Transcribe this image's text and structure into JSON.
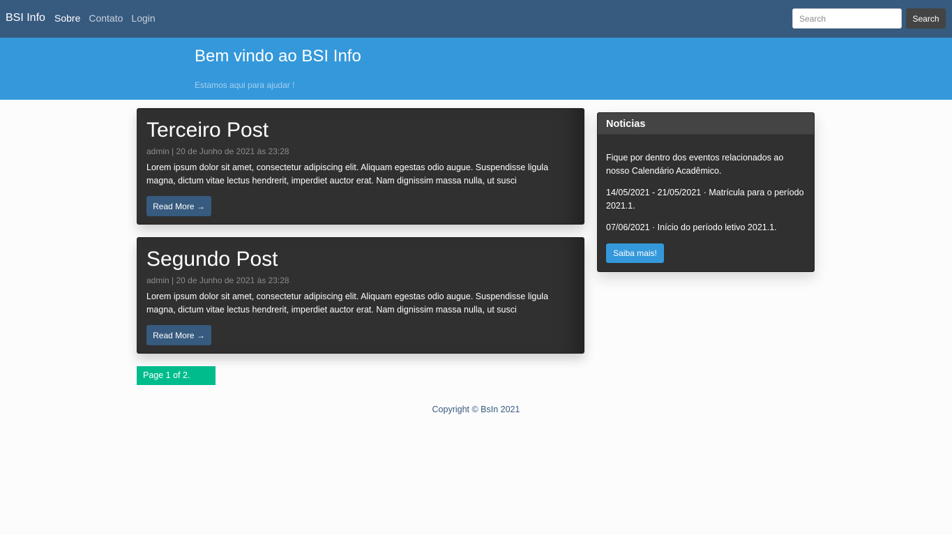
{
  "navbar": {
    "brand": "BSI Info",
    "links": [
      {
        "label": "Sobre",
        "active": true
      },
      {
        "label": "Contato",
        "active": false
      },
      {
        "label": "Login",
        "active": false
      }
    ],
    "search_placeholder": "Search",
    "search_button": "Search"
  },
  "hero": {
    "title": "Bem vindo ao BSI Info",
    "subtitle": "Estamos aqui para ajudar !"
  },
  "posts": [
    {
      "title": "Terceiro Post",
      "meta": "admin | 20 de Junho de 2021 às 23:28",
      "excerpt": "Lorem ipsum dolor sit amet, consectetur adipiscing elit. Aliquam egestas odio augue. Suspendisse ligula magna, dictum vitae lectus hendrerit, imperdiet auctor erat. Nam dignissim massa nulla, ut susci",
      "button": "Read More →"
    },
    {
      "title": "Segundo Post",
      "meta": "admin | 20 de Junho de 2021 às 23:28",
      "excerpt": "Lorem ipsum dolor sit amet, consectetur adipiscing elit. Aliquam egestas odio augue. Suspendisse ligula magna, dictum vitae lectus hendrerit, imperdiet auctor erat. Nam dignissim massa nulla, ut susci",
      "button": "Read More →"
    }
  ],
  "pagination": {
    "text": "Page 1 of 2."
  },
  "sidebar": {
    "title": "Noticias",
    "paragraphs": [
      "Fique por dentro dos eventos relacionados ao nosso Calendário Acadêmico.",
      "14/05/2021 - 21/05/2021 · Matrícula para o período 2021.1.",
      "07/06/2021 · Início do período letivo 2021.1."
    ],
    "button": "Saiba mais!"
  },
  "footer": {
    "text": "Copyright © BsIn 2021"
  },
  "colors": {
    "navbar": "#375a7f",
    "hero": "#3498db",
    "card": "#303030",
    "success": "#00bc8c"
  }
}
